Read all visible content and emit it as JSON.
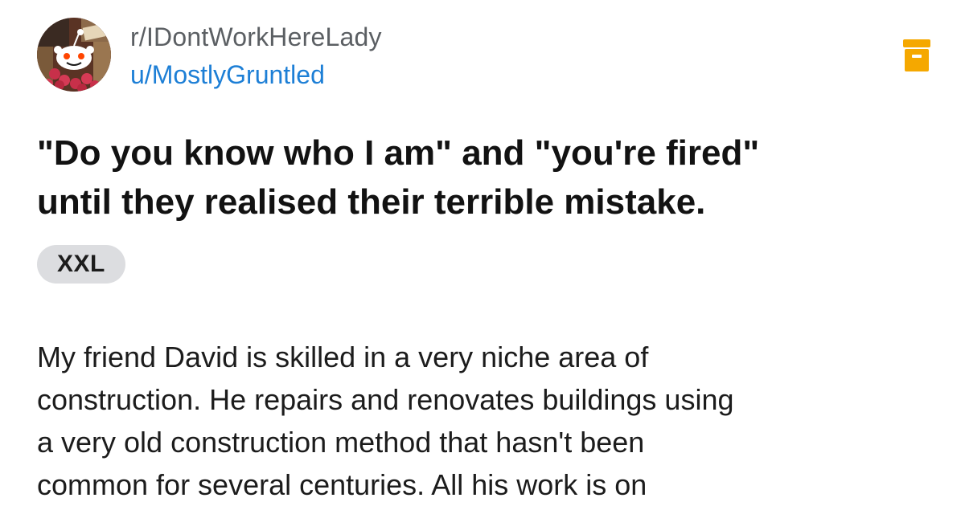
{
  "post": {
    "subreddit": "r/IDontWorkHereLady",
    "username": "u/MostlyGruntled",
    "title_line1": "\"Do you know who I am\" and \"you're fired\"",
    "title_line2": "until they realised their terrible mistake.",
    "flair": "XXL",
    "body_lines": [
      "My friend David is skilled in a very niche area of",
      "construction. He repairs and renovates buildings using",
      "a very old construction method that hasn't been",
      "common for several centuries. All his work is on"
    ]
  },
  "icons": {
    "avatar": "reddit-snoo-avatar",
    "archive": "archive-box-icon"
  },
  "colors": {
    "username": "#1d7fd6",
    "archive_icon": "#f5a800",
    "flair_background": "#dcdde0"
  }
}
